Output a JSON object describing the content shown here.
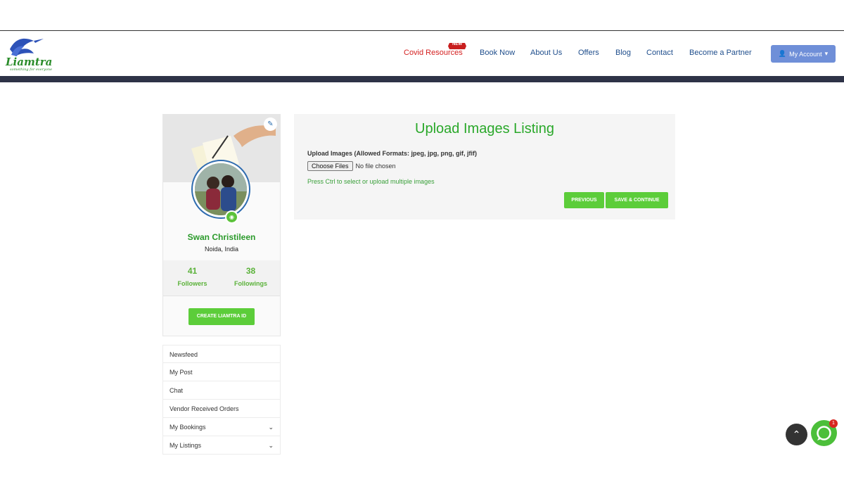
{
  "brand": {
    "logo_text": "Liamtra",
    "tagline": "something for everyone"
  },
  "nav": {
    "covid": "Covid Resources",
    "new_badge": "NEW",
    "book_now": "Book Now",
    "about": "About Us",
    "offers": "Offers",
    "blog": "Blog",
    "contact": "Contact",
    "partner": "Become a Partner",
    "account": "My Account"
  },
  "profile": {
    "name": "Swan Christileen",
    "location": "Noida, India",
    "followers_count": "41",
    "followers_label": "Followers",
    "followings_count": "38",
    "followings_label": "Followings",
    "create_button": "CREATE LIAMTRA ID"
  },
  "menu": {
    "items": [
      {
        "label": "Newsfeed"
      },
      {
        "label": "My Post"
      },
      {
        "label": "Chat"
      },
      {
        "label": "Vendor Received Orders"
      },
      {
        "label": "My Bookings"
      },
      {
        "label": "My Listings"
      }
    ]
  },
  "upload": {
    "title": "Upload Images Listing",
    "label": "Upload Images (Allowed Formats: jpeg, jpg, png, gif, jfif)",
    "choose_button": "Choose Files",
    "file_status": "No file chosen",
    "hint": "Press Ctrl to select or upload multiple images",
    "previous_button": "PREVIOUS",
    "save_button": "SAVE & CONTINUE"
  },
  "chat": {
    "badge_count": "1"
  },
  "colors": {
    "accent_green": "#5ccd3a",
    "title_green": "#2aa82a",
    "nav_blue": "#1f4e8c",
    "covid_red": "#d42020",
    "header_bar": "#2e3347",
    "account_btn": "#6f8fd8"
  },
  "icons": {
    "account": "user-icon",
    "account_caret": "chevron-down-icon",
    "cover_edit": "edit-icon",
    "camera": "camera-icon",
    "menu_chevron": "chevron-down-icon",
    "scroll_top": "chevron-up-icon",
    "chat": "chat-icon"
  }
}
